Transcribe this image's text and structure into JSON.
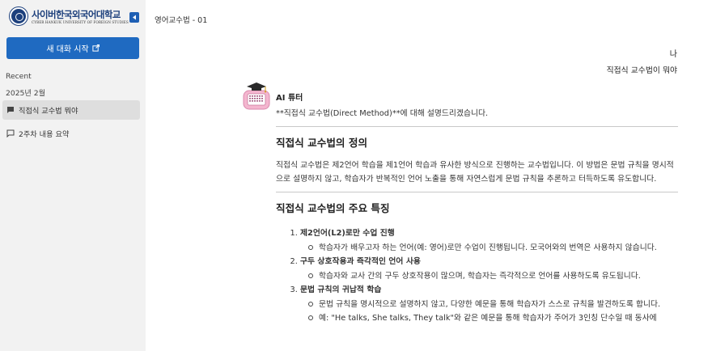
{
  "sidebar": {
    "logo": {
      "name": "사이버한국외국어대학교",
      "subtitle": "CYBER HANKUK UNIVERSITY OF FOREIGN STUDIES"
    },
    "new_chat_label": "새 대화 시작",
    "recent_label": "Recent",
    "month_label": "2025년 2월",
    "items": [
      {
        "label": "직접식 교수법 뭐야",
        "icon": "chat-bubble-filled-icon",
        "active": true
      },
      {
        "label": "2주차 내용 요약",
        "icon": "chat-bubble-outline-icon",
        "active": false
      }
    ]
  },
  "header": {
    "title": "영어교수법 - 01"
  },
  "conversation": {
    "user": {
      "name": "나",
      "message": "직접식 교수법이 뭐야"
    },
    "bot": {
      "name": "AI 튜터",
      "intro": "**직접식 교수법(Direct Method)**에 대해 설명드리겠습니다.",
      "section1_heading": "직접식 교수법의 정의",
      "section1_body": "직접식 교수법은 제2언어 학습을 제1언어 학습과 유사한 방식으로 진행하는 교수법입니다. 이 방법은 문법 규칙을 명시적으로 설명하지 않고, 학습자가 반복적인 언어 노출을 통해 자연스럽게 문법 규칙을 추론하고 터득하도록 유도합니다.",
      "section2_heading": "직접식 교수법의 주요 특징",
      "features": [
        {
          "title": "제2언어(L2)로만 수업 진행",
          "detail": "학습자가 배우고자 하는 언어(예: 영어)로만 수업이 진행됩니다. 모국어와의 번역은 사용하지 않습니다."
        },
        {
          "title": "구두 상호작용과 즉각적인 언어 사용",
          "detail": "학습자와 교사 간의 구두 상호작용이 많으며, 학습자는 즉각적으로 언어를 사용하도록 유도됩니다."
        },
        {
          "title": "문법 규칙의 귀납적 학습",
          "detail": "문법 규칙을 명시적으로 설명하지 않고, 다양한 예문을 통해 학습자가 스스로 규칙을 발견하도록 합니다.",
          "detail2": "예: \"He talks, She talks, They talk\"와 같은 예문을 통해 학습자가 주어가 3인칭 단수일 때 동사에"
        }
      ]
    }
  },
  "colors": {
    "brand": "#1c3f7c",
    "accent": "#1f6ac1",
    "sidebar_bg": "#f2f2f2",
    "active_item": "#dedede"
  }
}
